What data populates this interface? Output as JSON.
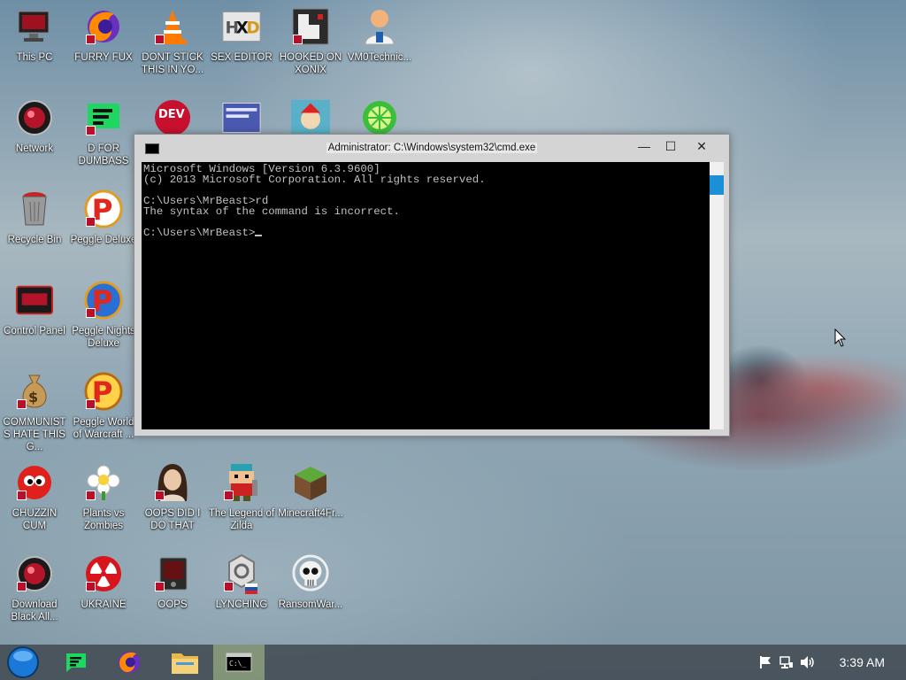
{
  "desktop": {
    "icons": [
      {
        "label": "This PC"
      },
      {
        "label": "FURRY FUX"
      },
      {
        "label": "DONT STICK THIS IN YO..."
      },
      {
        "label": "SEX EDITOR"
      },
      {
        "label": "HOOKED ON XONIX"
      },
      {
        "label": "VM0Technic..."
      },
      {
        "label": "Network"
      },
      {
        "label": "D FOR DUMBASS"
      },
      {
        "label": "Recycle Bin"
      },
      {
        "label": "Peggle Deluxe"
      },
      {
        "label": "Control Panel"
      },
      {
        "label": "Peggle Nights Deluxe"
      },
      {
        "label": "COMMUNISTS HATE THIS G..."
      },
      {
        "label": "Peggle World of Warcraft ..."
      },
      {
        "label": "CHUZZIN CUM"
      },
      {
        "label": "Plants vs Zombies"
      },
      {
        "label": "OOPS DID I DO THAT"
      },
      {
        "label": "The Legend of Zilda"
      },
      {
        "label": "Minecraft4Fr..."
      },
      {
        "label": "Download Black All..."
      },
      {
        "label": "UKRAINE"
      },
      {
        "label": "OOPS"
      },
      {
        "label": "LYNCHING"
      },
      {
        "label": "RansomWar..."
      }
    ]
  },
  "cmd": {
    "title": "Administrator: C:\\Windows\\system32\\cmd.exe",
    "min_glyph": "—",
    "max_glyph": "☐",
    "close_glyph": "✕",
    "lines": [
      "Microsoft Windows [Version 6.3.9600]",
      "(c) 2013 Microsoft Corporation. All rights reserved.",
      "",
      "C:\\Users\\MrBeast>rd",
      "The syntax of the command is incorrect.",
      "",
      "C:\\Users\\MrBeast>"
    ]
  },
  "taskbar": {
    "clock": "3:39 AM",
    "tray_icons": [
      "flag-icon",
      "network-icon",
      "volume-icon"
    ],
    "pinned": [
      "start-orb",
      "green-app-icon",
      "firefox-icon",
      "file-explorer-icon",
      "cmd-icon"
    ]
  },
  "colors": {
    "accent": "#1c8fd6",
    "console_bg": "#000000",
    "console_fg": "#c0c0c0",
    "security_shield": "#b8102a"
  }
}
